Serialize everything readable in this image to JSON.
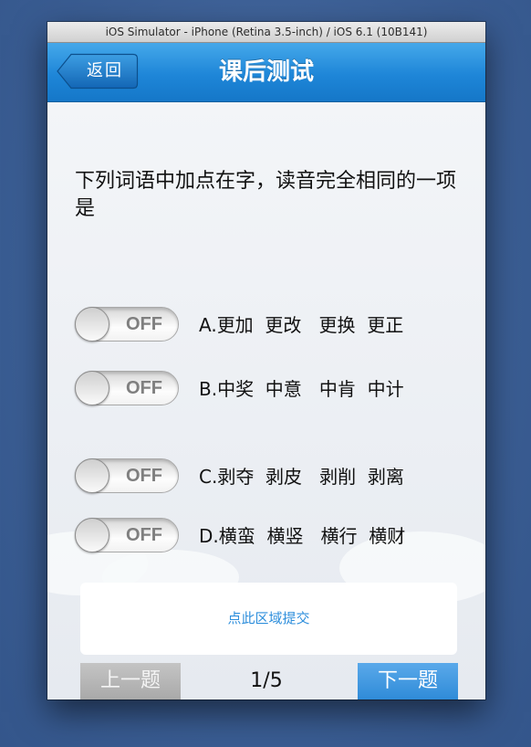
{
  "simulator": {
    "title": "iOS Simulator - iPhone (Retina 3.5-inch) / iOS 6.1 (10B141)"
  },
  "navbar": {
    "back_label": "返回",
    "title": "课后测试",
    "color": "#1e86d8"
  },
  "question": {
    "text": "下列词语中加点在字，读音完全相同的一项是"
  },
  "options": [
    {
      "switch_label": "OFF",
      "label": "A.更加  更改   更换  更正"
    },
    {
      "switch_label": "OFF",
      "label": "B.中奖  中意   中肯  中计"
    },
    {
      "switch_label": "OFF",
      "label": "C.剥夺  剥皮   剥削  剥离"
    },
    {
      "switch_label": "OFF",
      "label": "D.横蛮  横竖   横行  横财"
    }
  ],
  "submit": {
    "label": "点此区域提交",
    "color": "#2f8fdc"
  },
  "pager": {
    "prev_label": "上一题",
    "indicator": "1/5",
    "next_label": "下一题"
  }
}
